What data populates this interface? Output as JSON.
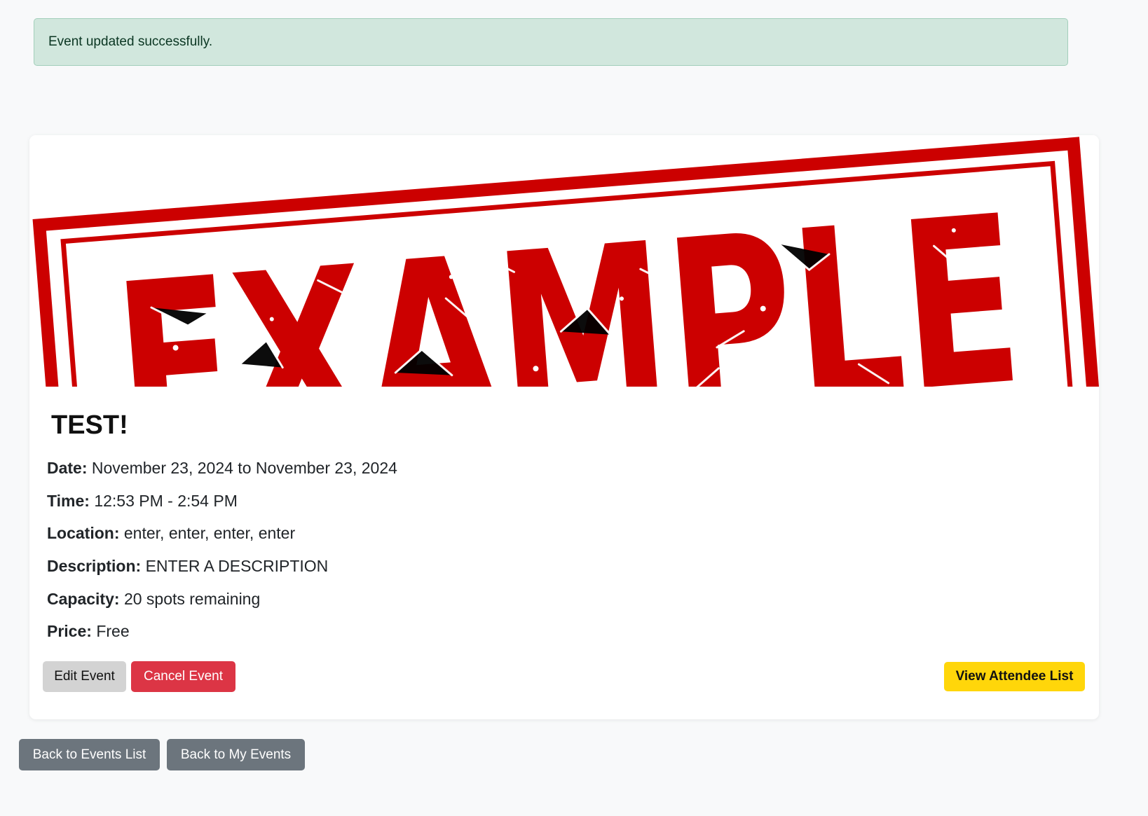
{
  "alert": {
    "message": "Event updated successfully.",
    "type": "success"
  },
  "event": {
    "image": {
      "stamp_text": "EXAMPLE",
      "stamp_color": "#cc0000"
    },
    "title": "TEST!",
    "details": {
      "date_label": "Date:",
      "date_value": "November 23, 2024 to November 23, 2024",
      "time_label": "Time:",
      "time_value": "12:53 PM - 2:54 PM",
      "location_label": "Location:",
      "location_value": "enter, enter, enter, enter",
      "description_label": "Description:",
      "description_value": "ENTER A DESCRIPTION",
      "capacity_label": "Capacity:",
      "capacity_value": "20 spots remaining",
      "price_label": "Price:",
      "price_value": "Free"
    },
    "actions": {
      "edit_label": "Edit Event",
      "cancel_label": "Cancel Event",
      "attendees_label": "View Attendee List"
    }
  },
  "navigation": {
    "back_events_label": "Back to Events List",
    "back_my_events_label": "Back to My Events"
  },
  "colors": {
    "success_bg": "#d1e7dd",
    "danger": "#dc3545",
    "warning": "#ffd60a",
    "secondary": "#6c757d"
  }
}
